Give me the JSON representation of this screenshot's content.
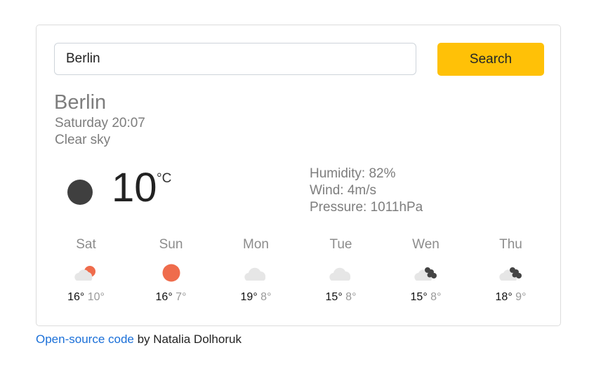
{
  "search": {
    "value": "Berlin",
    "button_label": "Search"
  },
  "current": {
    "city": "Berlin",
    "datetime": "Saturday 20:07",
    "description": "Clear sky",
    "icon": "clear-night-icon",
    "temperature": "10",
    "unit": "°C",
    "humidity": "Humidity: 82%",
    "wind": "Wind: 4m/s",
    "pressure": "Pressure: 1011hPa"
  },
  "forecast": [
    {
      "day": "Sat",
      "icon": "partly-cloudy-day-icon",
      "max": "16°",
      "min": "10°"
    },
    {
      "day": "Sun",
      "icon": "sun-icon",
      "max": "16°",
      "min": "7°"
    },
    {
      "day": "Mon",
      "icon": "cloud-icon",
      "max": "19°",
      "min": "8°"
    },
    {
      "day": "Tue",
      "icon": "cloud-icon",
      "max": "15°",
      "min": "8°"
    },
    {
      "day": "Wen",
      "icon": "broken-clouds-icon",
      "max": "15°",
      "min": "8°"
    },
    {
      "day": "Thu",
      "icon": "broken-clouds-icon",
      "max": "18°",
      "min": "9°"
    }
  ],
  "footer": {
    "link_text": "Open-source code",
    "suffix": " by Natalia Dolhoruk"
  },
  "colors": {
    "accent": "#ffc107",
    "sun": "#ef6c4c",
    "night": "#3f3f3f",
    "cloud": "#e6e6e6",
    "dark_cloud": "#444444",
    "link": "#1a6fd8"
  }
}
